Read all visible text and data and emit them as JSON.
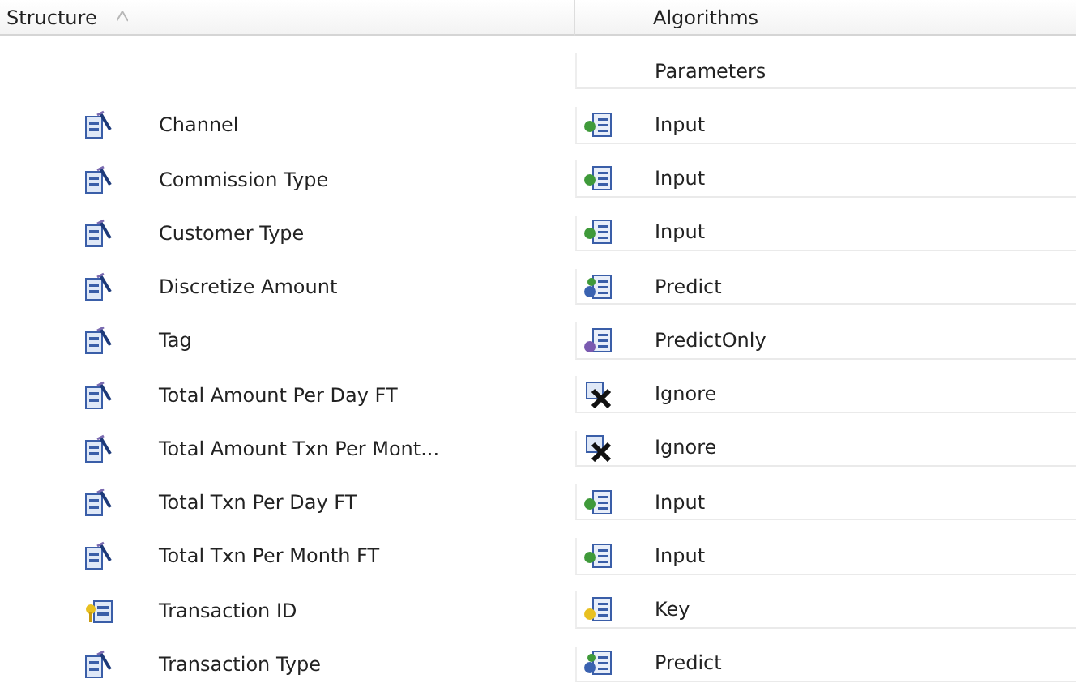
{
  "columns": [
    "Structure",
    "Algorithms"
  ],
  "sub_header": "Parameters",
  "rows": [
    {
      "name": "Channel",
      "kind": "column",
      "usage": {
        "label": "Input",
        "kind": "input"
      }
    },
    {
      "name": "Commission Type",
      "kind": "column",
      "usage": {
        "label": "Input",
        "kind": "input"
      }
    },
    {
      "name": "Customer Type",
      "kind": "column",
      "usage": {
        "label": "Input",
        "kind": "input"
      }
    },
    {
      "name": "Discretize Amount",
      "kind": "column",
      "usage": {
        "label": "Predict",
        "kind": "predict"
      }
    },
    {
      "name": "Tag",
      "kind": "column",
      "usage": {
        "label": "PredictOnly",
        "kind": "predictonly"
      }
    },
    {
      "name": "Total Amount Per Day FT",
      "kind": "column",
      "usage": {
        "label": "Ignore",
        "kind": "ignore"
      }
    },
    {
      "name": "Total Amount Txn Per Mont...",
      "kind": "column",
      "usage": {
        "label": "Ignore",
        "kind": "ignore"
      }
    },
    {
      "name": "Total Txn Per Day FT",
      "kind": "column",
      "usage": {
        "label": "Input",
        "kind": "input"
      }
    },
    {
      "name": "Total Txn Per Month FT",
      "kind": "column",
      "usage": {
        "label": "Input",
        "kind": "input"
      }
    },
    {
      "name": "Transaction ID",
      "kind": "key",
      "usage": {
        "label": "Key",
        "kind": "key"
      }
    },
    {
      "name": "Transaction Type",
      "kind": "column",
      "usage": {
        "label": "Predict",
        "kind": "predict"
      }
    }
  ]
}
